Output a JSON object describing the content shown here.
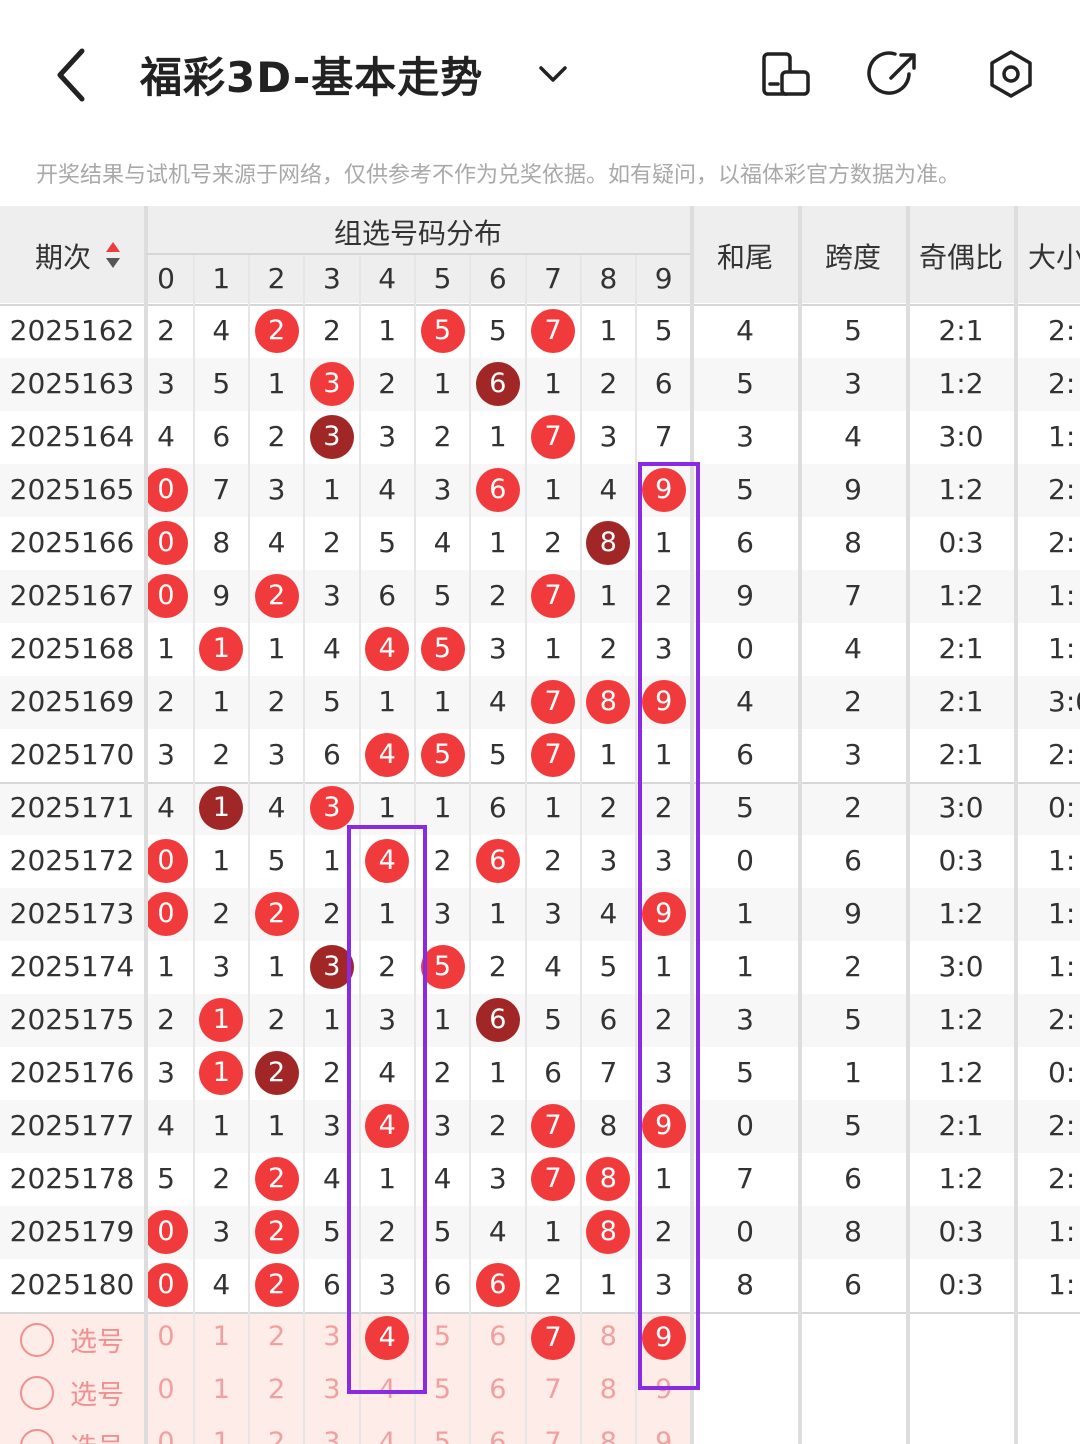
{
  "header": {
    "title": "福彩3D-基本走势",
    "icons": [
      "back-icon",
      "chevron-down-icon",
      "phone-rotate-icon",
      "share-icon",
      "settings-icon"
    ]
  },
  "notice": "开奖结果与试机号来源于网络，仅供参考不作为兑奖依据。如有疑问，以福体彩官方数据为准。",
  "table": {
    "period_header": "期次",
    "group_header": "组选号码分布",
    "digits": [
      "0",
      "1",
      "2",
      "3",
      "4",
      "5",
      "6",
      "7",
      "8",
      "9"
    ],
    "stat_headers": [
      "和尾",
      "跨度",
      "奇偶比",
      "大小"
    ],
    "rows": [
      {
        "period": "2025162",
        "cells": [
          [
            "2",
            ""
          ],
          [
            "4",
            ""
          ],
          [
            "2",
            "red"
          ],
          [
            "2",
            ""
          ],
          [
            "1",
            ""
          ],
          [
            "5",
            "red"
          ],
          [
            "5",
            ""
          ],
          [
            "7",
            "red"
          ],
          [
            "1",
            ""
          ],
          [
            "5",
            ""
          ]
        ],
        "stats": [
          "4",
          "5",
          "2:1",
          "2:"
        ]
      },
      {
        "period": "2025163",
        "cells": [
          [
            "3",
            ""
          ],
          [
            "5",
            ""
          ],
          [
            "1",
            ""
          ],
          [
            "3",
            "red"
          ],
          [
            "2",
            ""
          ],
          [
            "1",
            ""
          ],
          [
            "6",
            "dark"
          ],
          [
            "1",
            ""
          ],
          [
            "2",
            ""
          ],
          [
            "6",
            ""
          ]
        ],
        "stats": [
          "5",
          "3",
          "1:2",
          "2:"
        ]
      },
      {
        "period": "2025164",
        "cells": [
          [
            "4",
            ""
          ],
          [
            "6",
            ""
          ],
          [
            "2",
            ""
          ],
          [
            "3",
            "dark"
          ],
          [
            "3",
            ""
          ],
          [
            "2",
            ""
          ],
          [
            "1",
            ""
          ],
          [
            "7",
            "red"
          ],
          [
            "3",
            ""
          ],
          [
            "7",
            ""
          ]
        ],
        "stats": [
          "3",
          "4",
          "3:0",
          "1:"
        ]
      },
      {
        "period": "2025165",
        "cells": [
          [
            "0",
            "red"
          ],
          [
            "7",
            ""
          ],
          [
            "3",
            ""
          ],
          [
            "1",
            ""
          ],
          [
            "4",
            ""
          ],
          [
            "3",
            ""
          ],
          [
            "6",
            "red"
          ],
          [
            "1",
            ""
          ],
          [
            "4",
            ""
          ],
          [
            "9",
            "red"
          ]
        ],
        "stats": [
          "5",
          "9",
          "1:2",
          "2:"
        ]
      },
      {
        "period": "2025166",
        "cells": [
          [
            "0",
            "red"
          ],
          [
            "8",
            ""
          ],
          [
            "4",
            ""
          ],
          [
            "2",
            ""
          ],
          [
            "5",
            ""
          ],
          [
            "4",
            ""
          ],
          [
            "1",
            ""
          ],
          [
            "2",
            ""
          ],
          [
            "8",
            "dark"
          ],
          [
            "1",
            ""
          ]
        ],
        "stats": [
          "6",
          "8",
          "0:3",
          "2:"
        ]
      },
      {
        "period": "2025167",
        "cells": [
          [
            "0",
            "red"
          ],
          [
            "9",
            ""
          ],
          [
            "2",
            "red"
          ],
          [
            "3",
            ""
          ],
          [
            "6",
            ""
          ],
          [
            "5",
            ""
          ],
          [
            "2",
            ""
          ],
          [
            "7",
            "red"
          ],
          [
            "1",
            ""
          ],
          [
            "2",
            ""
          ]
        ],
        "stats": [
          "9",
          "7",
          "1:2",
          "1:"
        ]
      },
      {
        "period": "2025168",
        "cells": [
          [
            "1",
            ""
          ],
          [
            "1",
            "red"
          ],
          [
            "1",
            ""
          ],
          [
            "4",
            ""
          ],
          [
            "4",
            "red"
          ],
          [
            "5",
            "red"
          ],
          [
            "3",
            ""
          ],
          [
            "1",
            ""
          ],
          [
            "2",
            ""
          ],
          [
            "3",
            ""
          ]
        ],
        "stats": [
          "0",
          "4",
          "2:1",
          "1:"
        ]
      },
      {
        "period": "2025169",
        "cells": [
          [
            "2",
            ""
          ],
          [
            "1",
            ""
          ],
          [
            "2",
            ""
          ],
          [
            "5",
            ""
          ],
          [
            "1",
            ""
          ],
          [
            "1",
            ""
          ],
          [
            "4",
            ""
          ],
          [
            "7",
            "red"
          ],
          [
            "8",
            "red"
          ],
          [
            "9",
            "red"
          ]
        ],
        "stats": [
          "4",
          "2",
          "2:1",
          "3:0"
        ]
      },
      {
        "period": "2025170",
        "cells": [
          [
            "3",
            ""
          ],
          [
            "2",
            ""
          ],
          [
            "3",
            ""
          ],
          [
            "6",
            ""
          ],
          [
            "4",
            "red"
          ],
          [
            "5",
            "red"
          ],
          [
            "5",
            ""
          ],
          [
            "7",
            "red"
          ],
          [
            "1",
            ""
          ],
          [
            "1",
            ""
          ]
        ],
        "stats": [
          "6",
          "3",
          "2:1",
          "2:"
        ]
      },
      {
        "period": "2025171",
        "cells": [
          [
            "4",
            ""
          ],
          [
            "1",
            "dark"
          ],
          [
            "4",
            ""
          ],
          [
            "3",
            "red"
          ],
          [
            "1",
            ""
          ],
          [
            "1",
            ""
          ],
          [
            "6",
            ""
          ],
          [
            "1",
            ""
          ],
          [
            "2",
            ""
          ],
          [
            "2",
            ""
          ]
        ],
        "stats": [
          "5",
          "2",
          "3:0",
          "0:"
        ]
      },
      {
        "period": "2025172",
        "cells": [
          [
            "0",
            "red"
          ],
          [
            "1",
            ""
          ],
          [
            "5",
            ""
          ],
          [
            "1",
            ""
          ],
          [
            "4",
            "red"
          ],
          [
            "2",
            ""
          ],
          [
            "6",
            "red"
          ],
          [
            "2",
            ""
          ],
          [
            "3",
            ""
          ],
          [
            "3",
            ""
          ]
        ],
        "stats": [
          "0",
          "6",
          "0:3",
          "1:"
        ]
      },
      {
        "period": "2025173",
        "cells": [
          [
            "0",
            "red"
          ],
          [
            "2",
            ""
          ],
          [
            "2",
            "red"
          ],
          [
            "2",
            ""
          ],
          [
            "1",
            ""
          ],
          [
            "3",
            ""
          ],
          [
            "1",
            ""
          ],
          [
            "3",
            ""
          ],
          [
            "4",
            ""
          ],
          [
            "9",
            "red"
          ]
        ],
        "stats": [
          "1",
          "9",
          "1:2",
          "1:"
        ]
      },
      {
        "period": "2025174",
        "cells": [
          [
            "1",
            ""
          ],
          [
            "3",
            ""
          ],
          [
            "1",
            ""
          ],
          [
            "3",
            "dark"
          ],
          [
            "2",
            ""
          ],
          [
            "5",
            "red"
          ],
          [
            "2",
            ""
          ],
          [
            "4",
            ""
          ],
          [
            "5",
            ""
          ],
          [
            "1",
            ""
          ]
        ],
        "stats": [
          "1",
          "2",
          "3:0",
          "1:"
        ]
      },
      {
        "period": "2025175",
        "cells": [
          [
            "2",
            ""
          ],
          [
            "1",
            "red"
          ],
          [
            "2",
            ""
          ],
          [
            "1",
            ""
          ],
          [
            "3",
            ""
          ],
          [
            "1",
            ""
          ],
          [
            "6",
            "dark"
          ],
          [
            "5",
            ""
          ],
          [
            "6",
            ""
          ],
          [
            "2",
            ""
          ]
        ],
        "stats": [
          "3",
          "5",
          "1:2",
          "2:"
        ]
      },
      {
        "period": "2025176",
        "cells": [
          [
            "3",
            ""
          ],
          [
            "1",
            "red"
          ],
          [
            "2",
            "dark"
          ],
          [
            "2",
            ""
          ],
          [
            "4",
            ""
          ],
          [
            "2",
            ""
          ],
          [
            "1",
            ""
          ],
          [
            "6",
            ""
          ],
          [
            "7",
            ""
          ],
          [
            "3",
            ""
          ]
        ],
        "stats": [
          "5",
          "1",
          "1:2",
          "0:"
        ]
      },
      {
        "period": "2025177",
        "cells": [
          [
            "4",
            ""
          ],
          [
            "1",
            ""
          ],
          [
            "1",
            ""
          ],
          [
            "3",
            ""
          ],
          [
            "4",
            "red"
          ],
          [
            "3",
            ""
          ],
          [
            "2",
            ""
          ],
          [
            "7",
            "red"
          ],
          [
            "8",
            ""
          ],
          [
            "9",
            "red"
          ]
        ],
        "stats": [
          "0",
          "5",
          "2:1",
          "2:"
        ]
      },
      {
        "period": "2025178",
        "cells": [
          [
            "5",
            ""
          ],
          [
            "2",
            ""
          ],
          [
            "2",
            "red"
          ],
          [
            "4",
            ""
          ],
          [
            "1",
            ""
          ],
          [
            "4",
            ""
          ],
          [
            "3",
            ""
          ],
          [
            "7",
            "red"
          ],
          [
            "8",
            "red"
          ],
          [
            "1",
            ""
          ]
        ],
        "stats": [
          "7",
          "6",
          "1:2",
          "2:"
        ]
      },
      {
        "period": "2025179",
        "cells": [
          [
            "0",
            "red"
          ],
          [
            "3",
            ""
          ],
          [
            "2",
            "red"
          ],
          [
            "5",
            ""
          ],
          [
            "2",
            ""
          ],
          [
            "5",
            ""
          ],
          [
            "4",
            ""
          ],
          [
            "1",
            ""
          ],
          [
            "8",
            "red"
          ],
          [
            "2",
            ""
          ]
        ],
        "stats": [
          "0",
          "8",
          "0:3",
          "1:"
        ]
      },
      {
        "period": "2025180",
        "cells": [
          [
            "0",
            "red"
          ],
          [
            "4",
            ""
          ],
          [
            "2",
            "red"
          ],
          [
            "6",
            ""
          ],
          [
            "3",
            ""
          ],
          [
            "6",
            ""
          ],
          [
            "6",
            "red"
          ],
          [
            "2",
            ""
          ],
          [
            "1",
            ""
          ],
          [
            "3",
            ""
          ]
        ],
        "stats": [
          "8",
          "6",
          "0:3",
          "1:"
        ]
      }
    ],
    "select_rows": [
      {
        "label": "选号",
        "selected": [
          4,
          7,
          9
        ]
      },
      {
        "label": "选号",
        "selected": []
      },
      {
        "label": "选号",
        "selected": []
      }
    ]
  },
  "colors": {
    "red_ball": "#f13a3b",
    "dark_ball": "#a12626",
    "highlight_box": "#8a2be2",
    "select_bg": "#fdece8"
  }
}
